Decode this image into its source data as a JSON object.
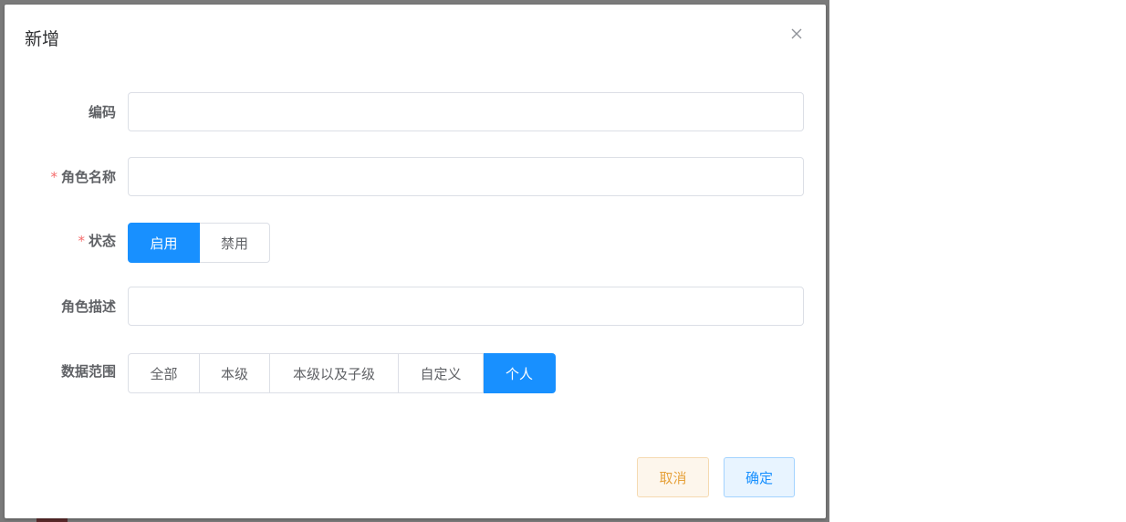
{
  "dialog": {
    "title": "新增"
  },
  "form": {
    "code": {
      "label": "编码",
      "value": "",
      "placeholder": "",
      "required": false
    },
    "role_name": {
      "label": "角色名称",
      "value": "",
      "placeholder": "",
      "required": true
    },
    "status": {
      "label": "状态",
      "required": true,
      "options": [
        "启用",
        "禁用"
      ],
      "selected": "启用"
    },
    "role_desc": {
      "label": "角色描述",
      "value": "",
      "placeholder": "",
      "required": false
    },
    "data_scope": {
      "label": "数据范围",
      "required": false,
      "options": [
        "全部",
        "本级",
        "本级以及子级",
        "自定义",
        "个人"
      ],
      "selected": "个人"
    }
  },
  "footer": {
    "cancel_label": "取消",
    "confirm_label": "确定"
  },
  "colors": {
    "primary": "#1890ff",
    "required_star": "#f56c6c",
    "cancel_text": "#e6a23c",
    "cancel_bg": "#fdf6ec",
    "confirm_bg": "#e8f4ff",
    "backdrop": "#7a7a7a"
  }
}
